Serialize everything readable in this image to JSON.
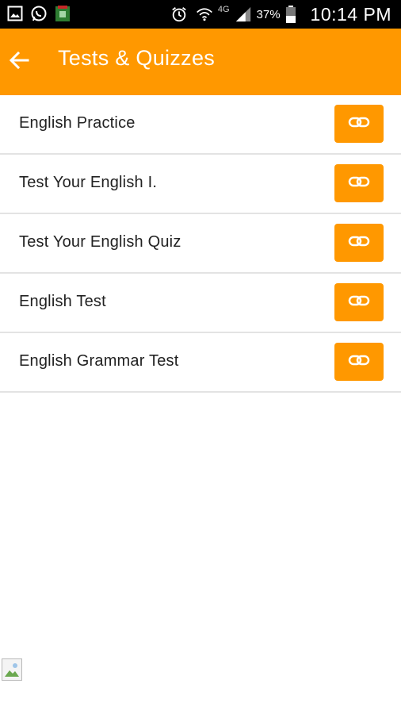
{
  "status_bar": {
    "left_icons": [
      "gallery-icon",
      "whatsapp-icon",
      "app-notification-icon"
    ],
    "network_label": "4G",
    "battery_percent": "37%",
    "time": "10:14 PM"
  },
  "app_bar": {
    "title": "Tests & Quizzes",
    "back_icon": "arrow-back-icon"
  },
  "list": {
    "items": [
      {
        "label": "English Practice",
        "icon": "link-icon"
      },
      {
        "label": "Test Your English I.",
        "icon": "link-icon"
      },
      {
        "label": "Test Your English Quiz",
        "icon": "link-icon"
      },
      {
        "label": "English Test",
        "icon": "link-icon"
      },
      {
        "label": "English Grammar Test",
        "icon": "link-icon"
      }
    ]
  },
  "colors": {
    "accent": "#FF9800",
    "status_bar": "#000000",
    "text": "#222222",
    "divider": "#E3E3E3"
  }
}
